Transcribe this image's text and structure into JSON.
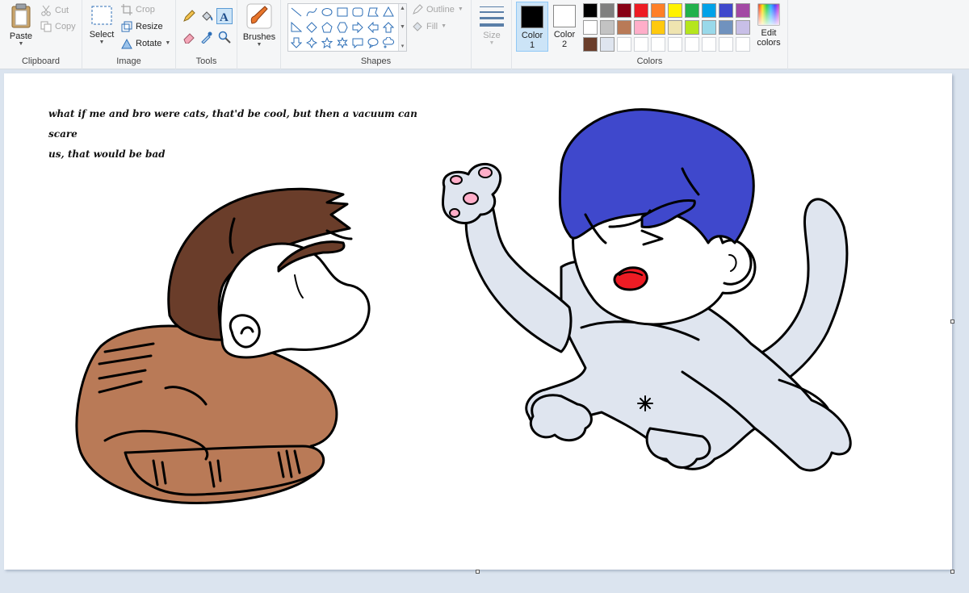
{
  "clipboard": {
    "paste_label": "Paste",
    "cut_label": "Cut",
    "copy_label": "Copy",
    "group_label": "Clipboard"
  },
  "image": {
    "select_label": "Select",
    "crop_label": "Crop",
    "resize_label": "Resize",
    "rotate_label": "Rotate",
    "group_label": "Image"
  },
  "tools": {
    "group_label": "Tools",
    "active_tool": "text"
  },
  "brushes": {
    "label": "Brushes"
  },
  "shapes": {
    "group_label": "Shapes",
    "outline_label": "Outline",
    "fill_label": "Fill"
  },
  "size": {
    "label": "Size"
  },
  "colors": {
    "color1_label": "Color",
    "color1_num": "1",
    "color2_label": "Color",
    "color2_num": "2",
    "edit_label_line1": "Edit",
    "edit_label_line2": "colors",
    "group_label": "Colors",
    "color1_value": "#000000",
    "color2_value": "#ffffff",
    "palette": [
      "#000000",
      "#7f7f7f",
      "#880015",
      "#ed1c24",
      "#ff7f27",
      "#fff200",
      "#22b14c",
      "#00a2e8",
      "#3f48cc",
      "#a349a4",
      "#ffffff",
      "#c3c3c3",
      "#b97a57",
      "#ffaec9",
      "#ffc90e",
      "#efe4b0",
      "#b5e61d",
      "#99d9ea",
      "#7092be",
      "#c8bfe7",
      "#6a3d2a",
      "#dfe5ef",
      "",
      "",
      "",
      "",
      "",
      "",
      "",
      ""
    ]
  },
  "canvas": {
    "caption_line1": "what if me and bro were cats, that'd be cool, but then a vacuum can scare",
    "caption_line2": "us, that would be bad",
    "brown_cat_body_color": "#b97a57",
    "brown_cat_hair_color": "#6a3d2a",
    "grey_cat_body_color": "#dfe5ef",
    "grey_cat_hair_color": "#3f48cc",
    "tongue_color": "#ed1c24",
    "paw_pad_color": "#ffaec9"
  }
}
